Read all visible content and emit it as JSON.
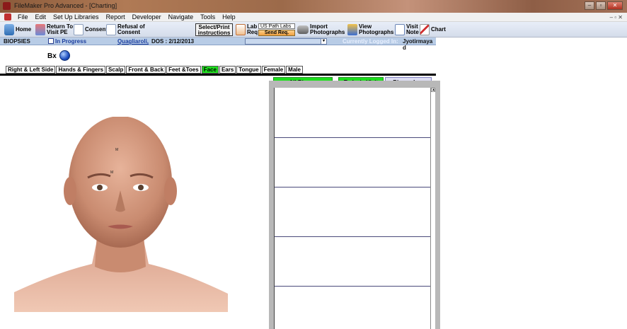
{
  "window": {
    "title": "FileMaker Pro Advanced - [Charting]"
  },
  "menu": [
    "File",
    "Edit",
    "Set Up Libraries",
    "Report",
    "Developer",
    "Navigate",
    "Tools",
    "Help"
  ],
  "toolbar": {
    "home": "Home",
    "return_line1": "Return To",
    "return_line2": "Visit PE",
    "consent": "Consent",
    "refusal_line1": "Refusal of",
    "refusal_line2": "Consent",
    "select_line1": "Select/Print",
    "select_line2": "instructions",
    "lab_line1": "Lab",
    "lab_line2": "Req",
    "lab_value": "US Path Labs",
    "send": "Send Req.",
    "import_line1": "Import",
    "import_line2": "Photographs",
    "view_line1": "View",
    "view_line2": "Photographs",
    "visit_line1": "Visit",
    "visit_line2": "Note",
    "chart": "Chart"
  },
  "status": {
    "section": "BIOPSIES",
    "state": "In Progress",
    "patient": "Quagliaroli,",
    "dos": "DOS : 2/12/2013",
    "logged_label": "Currently Logged In:",
    "user": "Jyotirmaya d"
  },
  "bx_label": "Bx",
  "body_tabs": [
    "Right & Left Side",
    "Hands & Fingers",
    "Scalp",
    "Front & Back",
    "Feet &Toes",
    "Face",
    "Ears",
    "Tongue",
    "Female",
    "Male"
  ],
  "active_tab": "Face",
  "figure_marks": [
    "M",
    "M"
  ],
  "right_tabs": {
    "all": "All Biopsy",
    "today": "Today's Visit",
    "log": "Biopsy Log"
  },
  "colors": {
    "active_tab": "#1ee01e",
    "status_bar": "#b8cce6",
    "panel_bg": "#b8b8b8"
  }
}
